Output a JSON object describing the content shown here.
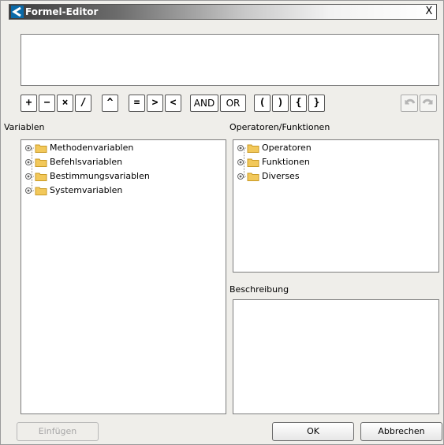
{
  "window": {
    "title": "Formel-Editor",
    "close_label": "X"
  },
  "operators": [
    "+",
    "−",
    "×",
    "/",
    "^",
    "=",
    ">",
    "<",
    "AND",
    "OR",
    "(",
    ")",
    "{",
    "}"
  ],
  "undo_icons": [
    "undo-icon",
    "redo-icon"
  ],
  "variables": {
    "label": "Variablen",
    "items": [
      "Methodenvariablen",
      "Befehlsvariablen",
      "Bestimmungsvariablen",
      "Systemvariablen"
    ]
  },
  "operators_panel": {
    "label": "Operatoren/Funktionen",
    "items": [
      "Operatoren",
      "Funktionen",
      "Diverses"
    ]
  },
  "description": {
    "label": "Beschreibung"
  },
  "buttons": {
    "insert": "Einfügen",
    "ok": "OK",
    "cancel": "Abbrechen"
  },
  "colors": {
    "folder": "#f2c85a",
    "title_bar_dark": "#3c3c3c"
  }
}
